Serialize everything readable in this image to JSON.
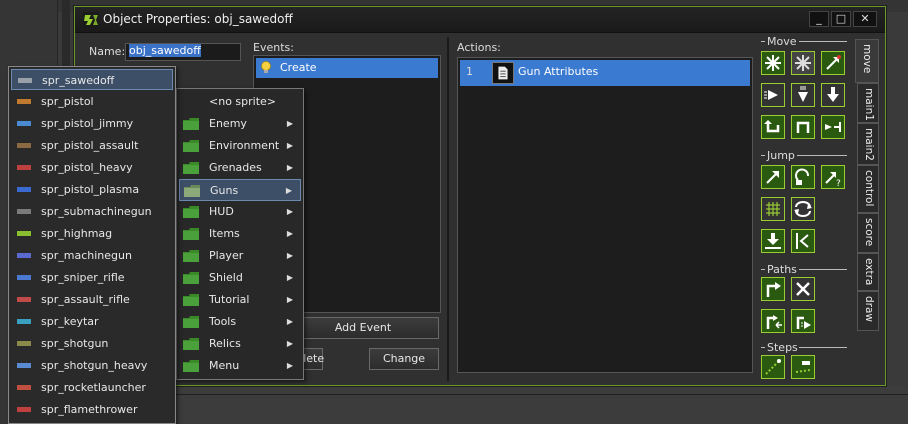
{
  "window": {
    "title": "Object Properties: obj_sawedoff",
    "min_glyph": "_",
    "max_glyph": "□",
    "close_glyph": "✕"
  },
  "name_field": {
    "label": "Name:",
    "value": "obj_sawedoff"
  },
  "events": {
    "label": "Events:",
    "items": [
      {
        "label": "Create",
        "selected": true
      }
    ],
    "add_button": "Add Event",
    "delete_button": "Delete",
    "change_button": "Change"
  },
  "actions": {
    "label": "Actions:",
    "items": [
      {
        "number": "1",
        "label": "Gun Attributes"
      }
    ]
  },
  "tool_panel": {
    "groups": [
      {
        "label": "Move"
      },
      {
        "label": "Jump"
      },
      {
        "label": "Paths"
      },
      {
        "label": "Steps"
      }
    ]
  },
  "side_tabs": [
    {
      "label": "move",
      "active": true
    },
    {
      "label": "main1"
    },
    {
      "label": "main2"
    },
    {
      "label": "control"
    },
    {
      "label": "score"
    },
    {
      "label": "extra"
    },
    {
      "label": "draw"
    }
  ],
  "folder_menu": {
    "items": [
      {
        "label": "<no sprite>",
        "folder": false,
        "submenu": false
      },
      {
        "label": "Enemy",
        "folder": true,
        "submenu": true
      },
      {
        "label": "Environment",
        "folder": true,
        "submenu": true
      },
      {
        "label": "Grenades",
        "folder": true,
        "submenu": true
      },
      {
        "label": "Guns",
        "folder": true,
        "submenu": true,
        "highlighted": true
      },
      {
        "label": "HUD",
        "folder": true,
        "submenu": true
      },
      {
        "label": "Items",
        "folder": true,
        "submenu": true
      },
      {
        "label": "Player",
        "folder": true,
        "submenu": true
      },
      {
        "label": "Shield",
        "folder": true,
        "submenu": true
      },
      {
        "label": "Tutorial",
        "folder": true,
        "submenu": true
      },
      {
        "label": "Tools",
        "folder": true,
        "submenu": true
      },
      {
        "label": "Relics",
        "folder": true,
        "submenu": true
      },
      {
        "label": "Menu",
        "folder": true,
        "submenu": true
      }
    ]
  },
  "sprite_list": {
    "items": [
      {
        "label": "spr_sawedoff",
        "highlighted": true,
        "color": "#9aa0a8"
      },
      {
        "label": "spr_pistol",
        "color": "#c07a30"
      },
      {
        "label": "spr_pistol_jimmy",
        "color": "#4a8ad0"
      },
      {
        "label": "spr_pistol_assault",
        "color": "#8a6a40"
      },
      {
        "label": "spr_pistol_heavy",
        "color": "#c04040"
      },
      {
        "label": "spr_pistol_plasma",
        "color": "#3a6ad0"
      },
      {
        "label": "spr_submachinegun",
        "color": "#7a7a7a"
      },
      {
        "label": "spr_highmag",
        "color": "#8ac030"
      },
      {
        "label": "spr_machinegun",
        "color": "#5a6ad0"
      },
      {
        "label": "spr_sniper_rifle",
        "color": "#4a7ad0"
      },
      {
        "label": "spr_assault_rifle",
        "color": "#c04a4a"
      },
      {
        "label": "spr_keytar",
        "color": "#3aa0c0"
      },
      {
        "label": "spr_shotgun",
        "color": "#8a8a4a"
      },
      {
        "label": "spr_shotgun_heavy",
        "color": "#5a8ad0"
      },
      {
        "label": "spr_rocketlauncher",
        "color": "#c05040"
      },
      {
        "label": "spr_flamethrower",
        "color": "#c04040"
      }
    ]
  },
  "colors": {
    "accent_green": "#9acd32",
    "selection_blue": "#3a7ad0",
    "hover_blue": "#3d4f66"
  }
}
